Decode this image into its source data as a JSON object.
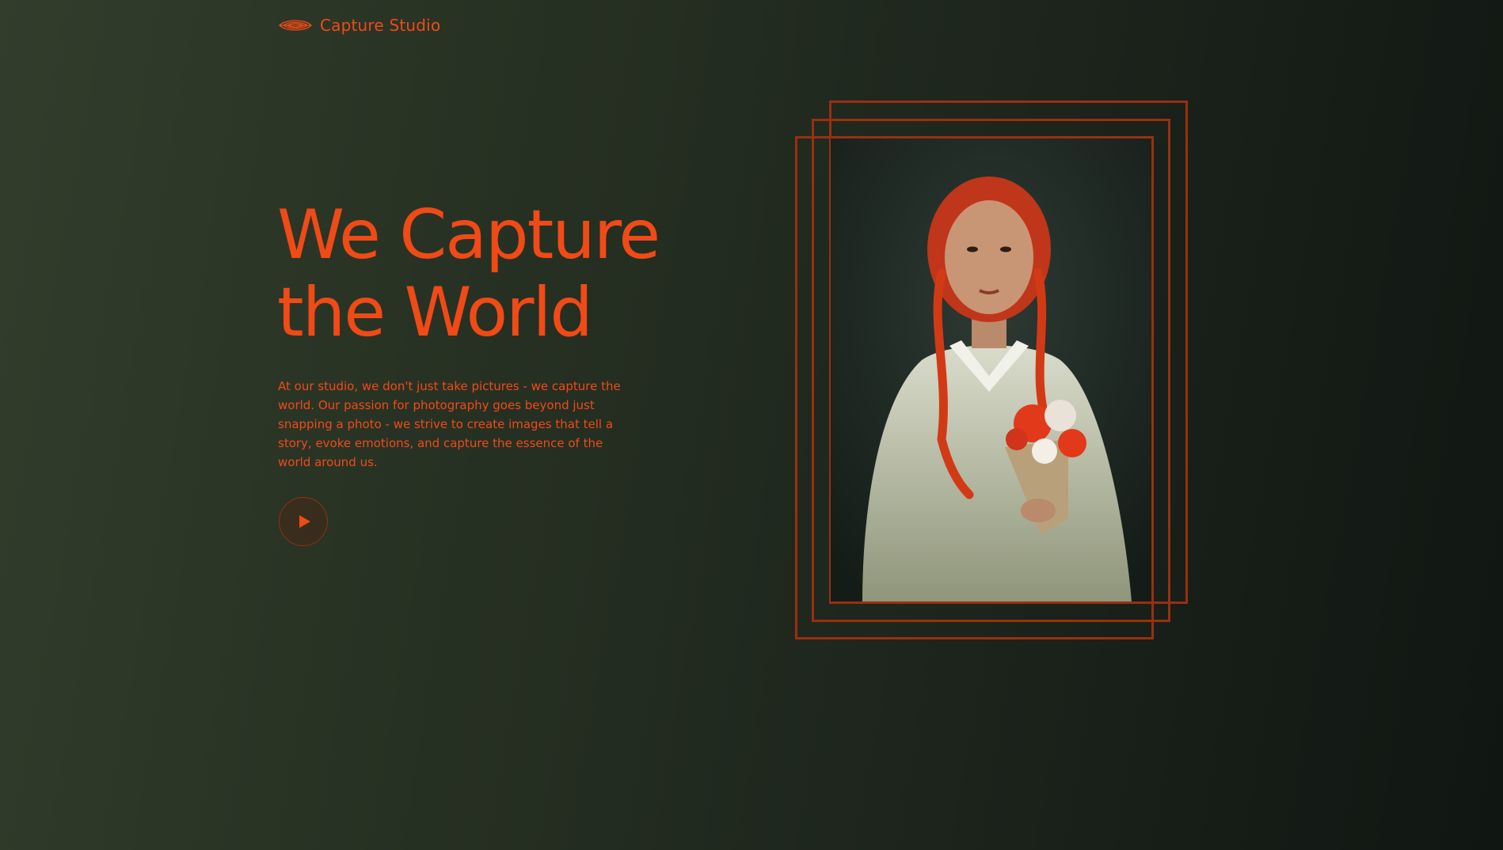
{
  "brand": {
    "name": "Capture Studio",
    "icon": "wave-lines-icon"
  },
  "hero": {
    "title_line1": "We Capture",
    "title_line2": "the World",
    "description": "At our studio, we don't just take pictures - we capture the world. Our passion for photography goes beyond just snapping a photo - we strive to create images that tell a story, evoke emotions, and capture the essence of the world around us.",
    "play_icon": "play-icon"
  },
  "photo": {
    "subject": "portrait-photo"
  },
  "colors": {
    "accent": "#f04a17",
    "frame": "#9a2f10",
    "background_dark": "#101612",
    "background_olive": "#323d2c"
  }
}
